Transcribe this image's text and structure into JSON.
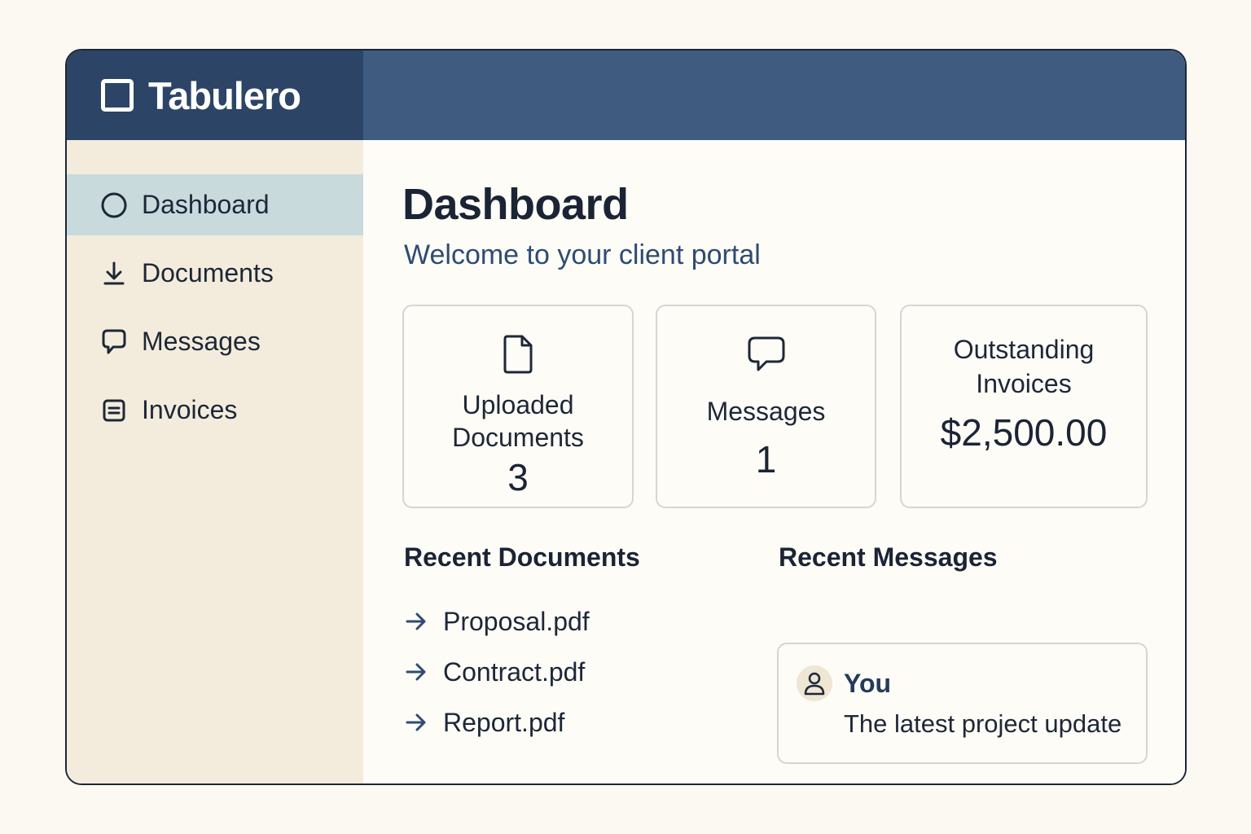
{
  "app": {
    "name": "Tabulero",
    "logo_icon": "square-icon"
  },
  "sidebar": {
    "items": [
      {
        "label": "Dashboard",
        "icon": "circle-icon",
        "active": true
      },
      {
        "label": "Documents",
        "icon": "download-icon",
        "active": false
      },
      {
        "label": "Messages",
        "icon": "chat-bubble-icon",
        "active": false
      },
      {
        "label": "Invoices",
        "icon": "invoice-icon",
        "active": false
      }
    ]
  },
  "main": {
    "title": "Dashboard",
    "subtitle": "Welcome to your client portal",
    "cards": {
      "documents": {
        "label_line1": "Uploaded",
        "label_line2": "Documents",
        "value": "3",
        "icon": "document-icon"
      },
      "messages": {
        "label": "Messages",
        "value": "1",
        "icon": "chat-bubble-icon"
      },
      "invoices": {
        "label_line1": "Outstanding",
        "label_line2": "Invoices",
        "value": "$2,500.00"
      }
    },
    "recent_documents": {
      "title": "Recent Documents",
      "items": [
        "Proposal.pdf",
        "Contract.pdf",
        "Report.pdf"
      ]
    },
    "recent_messages": {
      "title": "Recent Messages",
      "items": [
        {
          "sender": "You",
          "text": "The latest project update",
          "icon": "user-icon"
        }
      ]
    }
  },
  "colors": {
    "brand_dark": "#2c4465",
    "topbar": "#3f5c80",
    "sidebar_bg": "#f3ecdc",
    "active_nav": "#c9dadd",
    "accent_text": "#2f4b72"
  }
}
